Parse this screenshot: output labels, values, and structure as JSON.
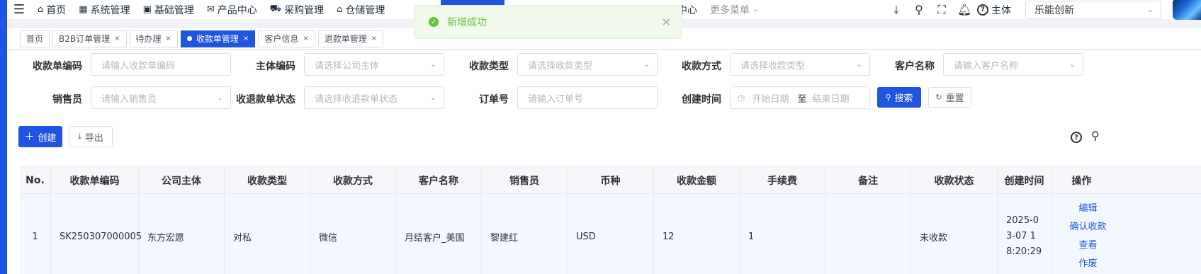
{
  "nav": {
    "items": [
      {
        "label": "首页",
        "icon": "home-icon"
      },
      {
        "label": "系统管理",
        "icon": "system-icon"
      },
      {
        "label": "基础管理",
        "icon": "grid-icon"
      },
      {
        "label": "产品中心",
        "icon": "mail-icon"
      },
      {
        "label": "采购管理",
        "icon": "cart-icon"
      },
      {
        "label": "仓储管理",
        "icon": "warehouse-icon"
      }
    ],
    "pda_label": "PDA设置中心",
    "more_label": "更多菜单",
    "entity_label": "主体",
    "entity_value": "乐能创新"
  },
  "toast": {
    "message": "新增成功"
  },
  "tabs": [
    {
      "label": "首页",
      "closable": false
    },
    {
      "label": "B2B订单管理",
      "closable": true
    },
    {
      "label": "待办理",
      "closable": true
    },
    {
      "label": "收款单管理",
      "closable": true,
      "active": true
    },
    {
      "label": "客户信息",
      "closable": true
    },
    {
      "label": "退款单管理",
      "closable": true
    }
  ],
  "filters": {
    "receipt_no": {
      "label": "收款单编码",
      "placeholder": "请输入收款单编码"
    },
    "entity_code": {
      "label": "主体编码",
      "placeholder": "请选择公司主体"
    },
    "receipt_type": {
      "label": "收款类型",
      "placeholder": "请选择收款类型"
    },
    "receipt_method": {
      "label": "收款方式",
      "placeholder": "请选择收款类型"
    },
    "customer": {
      "label": "客户名称",
      "placeholder": "请输入客户名称"
    },
    "salesperson": {
      "label": "销售员",
      "placeholder": "请输入销售员"
    },
    "status": {
      "label": "收退款单状态",
      "placeholder": "请选择收退款单状态"
    },
    "order_no": {
      "label": "订单号",
      "placeholder": "请输入订单号"
    },
    "created": {
      "label": "创建时间",
      "start_placeholder": "开始日期",
      "separator": "至",
      "end_placeholder": "结束日期"
    }
  },
  "actions": {
    "search": "搜索",
    "reset": "重置",
    "create": "创建",
    "export": "导出"
  },
  "table": {
    "headers": [
      "No.",
      "收款单编码",
      "公司主体",
      "收款类型",
      "收款方式",
      "客户名称",
      "销售员",
      "币种",
      "收款金额",
      "手续费",
      "备注",
      "收款状态",
      "创建时间",
      "操作"
    ],
    "rows": [
      {
        "no": "1",
        "code": "SK250307000005",
        "entity": "东方宏愿",
        "type": "对私",
        "method": "微信",
        "customer": "月结客户_美国",
        "sales": "黎建红",
        "currency": "USD",
        "amount": "12",
        "fee": "1",
        "remark": "",
        "status": "未收款",
        "created": "2025-03-07 18:20:29",
        "ops": [
          "编辑",
          "确认收款",
          "查看",
          "作废"
        ]
      }
    ]
  }
}
